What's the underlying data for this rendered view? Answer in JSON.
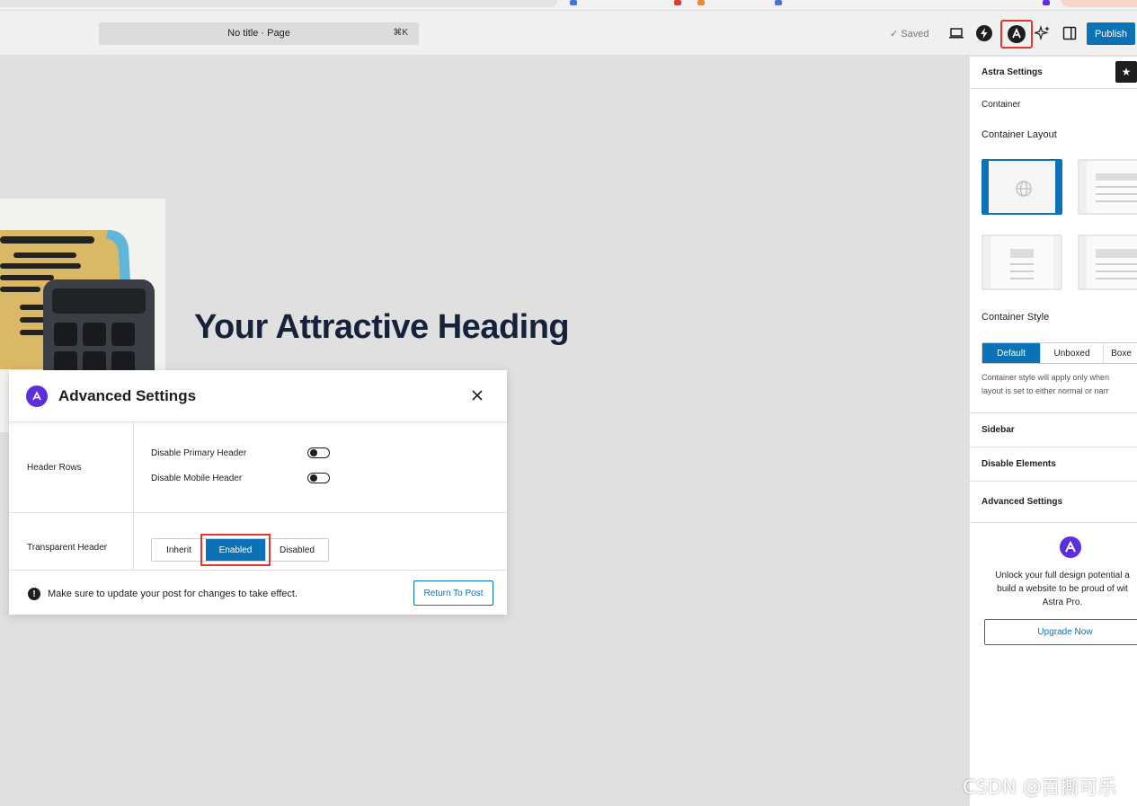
{
  "topbar": {
    "doc_title": "No title · Page",
    "shortcut": "⌘K",
    "saved_label": "✓ Saved",
    "publish_label": "Publish"
  },
  "canvas": {
    "heading": "Your Attractive Heading"
  },
  "sidebar": {
    "title": "Astra Settings",
    "container_section": "Container",
    "container_layout_label": "Container Layout",
    "container_style_label": "Container Style",
    "style_options": [
      "Default",
      "Unboxed",
      "Boxe"
    ],
    "style_selected": "Default",
    "style_help_1": "Container style will apply only when",
    "style_help_2": "layout is set to either normal or narr",
    "sections": [
      "Sidebar",
      "Disable Elements",
      "Advanced Settings"
    ],
    "promo_1": "Unlock your full design potential a",
    "promo_2": "build a website to be proud of wit",
    "promo_3": "Astra Pro.",
    "upgrade_label": "Upgrade Now"
  },
  "modal": {
    "title": "Advanced Settings",
    "header_rows_label": "Header Rows",
    "disable_primary_label": "Disable Primary Header",
    "disable_mobile_label": "Disable Mobile Header",
    "transparent_label": "Transparent Header",
    "transparent_options": [
      "Inherit",
      "Enabled",
      "Disabled"
    ],
    "transparent_selected": "Enabled",
    "footer_note": "Make sure to update your post for changes to take effect.",
    "return_label": "Return To Post"
  },
  "watermark": "CSDN @百撕可乐",
  "colors": {
    "accent": "#0b72b5",
    "highlight": "#e2372a",
    "astra_purple": "#5c2ede"
  }
}
